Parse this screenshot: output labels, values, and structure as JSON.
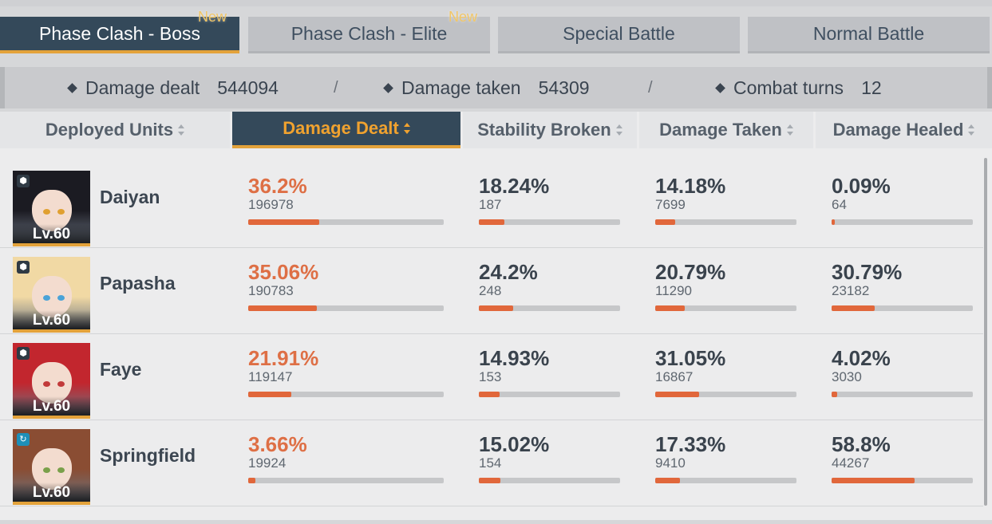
{
  "mode_tabs": [
    {
      "label": "Phase Clash - Boss",
      "new": "New",
      "active": true
    },
    {
      "label": "Phase Clash - Elite",
      "new": "New",
      "active": false
    },
    {
      "label": "Special Battle",
      "new": "",
      "active": false
    },
    {
      "label": "Normal Battle",
      "new": "",
      "active": false
    }
  ],
  "summary": {
    "damage_dealt_label": "Damage dealt",
    "damage_dealt": "544094",
    "damage_taken_label": "Damage taken",
    "damage_taken": "54309",
    "combat_turns_label": "Combat turns",
    "combat_turns": "12",
    "separator": "/"
  },
  "columns": [
    "Deployed Units",
    "Damage Dealt",
    "Stability Broken",
    "Damage Taken",
    "Damage Healed"
  ],
  "active_column": 1,
  "units": [
    {
      "name": "Daiyan",
      "level": "Lv.60",
      "class_icon": "shield-icon",
      "stats": [
        {
          "pct": "36.2%",
          "value": "196978",
          "fraction": 0.362
        },
        {
          "pct": "18.24%",
          "value": "187",
          "fraction": 0.1824
        },
        {
          "pct": "14.18%",
          "value": "7699",
          "fraction": 0.1418
        },
        {
          "pct": "0.09%",
          "value": "64",
          "fraction": 0.0009
        }
      ]
    },
    {
      "name": "Papasha",
      "level": "Lv.60",
      "class_icon": "shield-icon",
      "stats": [
        {
          "pct": "35.06%",
          "value": "190783",
          "fraction": 0.3506
        },
        {
          "pct": "24.2%",
          "value": "248",
          "fraction": 0.242
        },
        {
          "pct": "20.79%",
          "value": "11290",
          "fraction": 0.2079
        },
        {
          "pct": "30.79%",
          "value": "23182",
          "fraction": 0.3079
        }
      ]
    },
    {
      "name": "Faye",
      "level": "Lv.60",
      "class_icon": "shield-icon",
      "stats": [
        {
          "pct": "21.91%",
          "value": "119147",
          "fraction": 0.2191
        },
        {
          "pct": "14.93%",
          "value": "153",
          "fraction": 0.1493
        },
        {
          "pct": "31.05%",
          "value": "16867",
          "fraction": 0.3105
        },
        {
          "pct": "4.02%",
          "value": "3030",
          "fraction": 0.0402
        }
      ]
    },
    {
      "name": "Springfield",
      "level": "Lv.60",
      "class_icon": "support-icon",
      "stats": [
        {
          "pct": "3.66%",
          "value": "19924",
          "fraction": 0.0366
        },
        {
          "pct": "15.02%",
          "value": "154",
          "fraction": 0.1502
        },
        {
          "pct": "17.33%",
          "value": "9410",
          "fraction": 0.1733
        },
        {
          "pct": "58.8%",
          "value": "44267",
          "fraction": 0.588
        }
      ]
    }
  ],
  "colors": {
    "accent": "#e3a23a",
    "active_tab": "#34495a",
    "bar_fill": "#e1673b",
    "highlight_text": "#de6f45"
  }
}
